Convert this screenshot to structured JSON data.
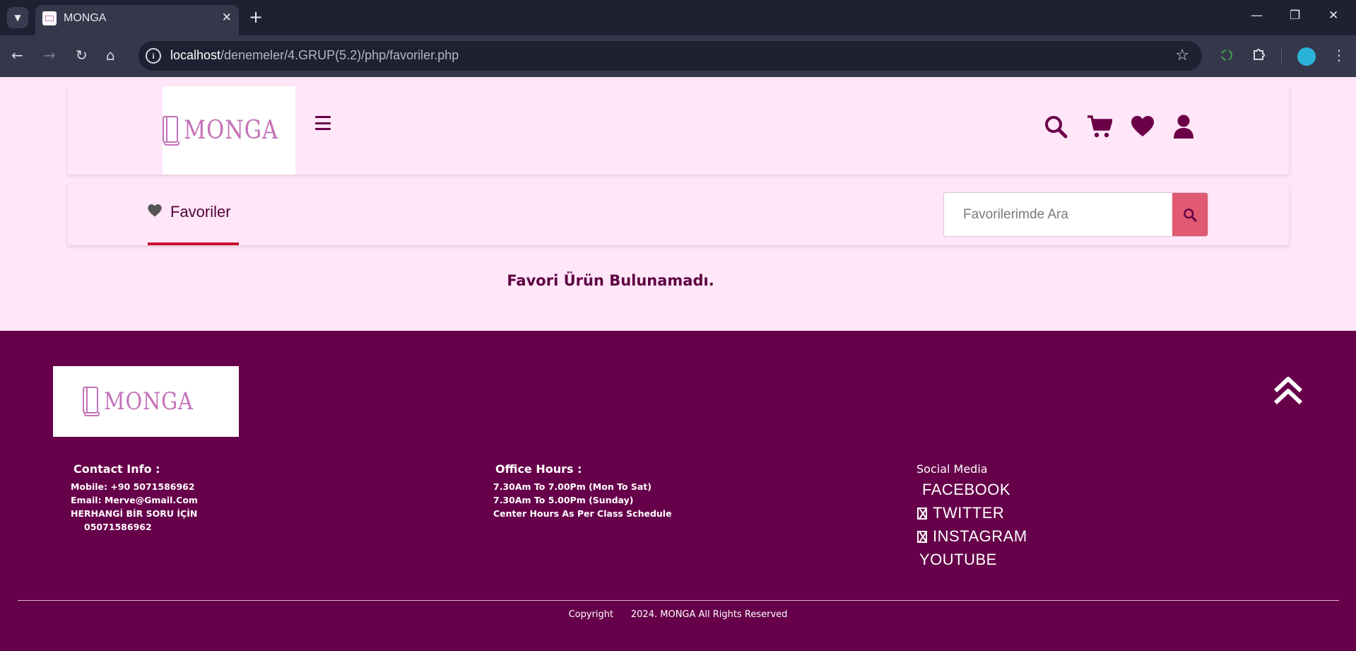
{
  "browser": {
    "tab_title": "MONGA",
    "url_host": "localhost",
    "url_path": "/denemeler/4.GRUP(5.2)/php/favoriler.php",
    "new_tab": "+",
    "close_tab": "✕"
  },
  "header": {
    "logo_text": "MONGA",
    "icons": [
      "menu-icon",
      "search-icon",
      "cart-icon",
      "heart-icon",
      "user-icon"
    ]
  },
  "favorites": {
    "tab_label": "Favoriler",
    "search_placeholder": "Favorilerimde Ara",
    "empty_message": "Favori Ürün Bulunamadı."
  },
  "footer": {
    "logo_text": "MONGA",
    "contact": {
      "title": "Contact Info :",
      "lines": [
        "Mobile: +90 5071586962",
        "Email: Merve@Gmail.Com",
        "HERHANGİ BİR SORU İÇİN",
        "05071586962"
      ]
    },
    "office": {
      "title": "Office Hours :",
      "lines": [
        "7.30Am To 7.00Pm (Mon To Sat)",
        "7.30Am To 5.00Pm (Sunday)",
        "Center Hours As Per Class Schedule"
      ]
    },
    "social": {
      "title": "Social Media",
      "links": [
        "FACEBOOK",
        "TWITTER",
        "INSTAGRAM",
        "YOUTUBE"
      ]
    },
    "copyright": "Copyright      2024. MONGA All Rights Reserved"
  },
  "colors": {
    "page_bg": "#ffe6f8",
    "brand_dark": "#6b0049",
    "footer_bg": "#67004a",
    "search_button": "#e05a72",
    "active_underline": "#c8102e",
    "logo_pink": "#c472b9"
  }
}
